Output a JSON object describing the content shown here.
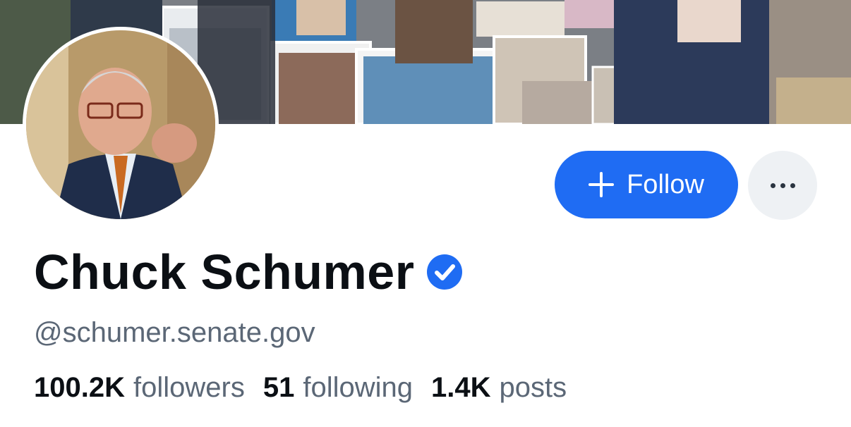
{
  "profile": {
    "display_name": "Chuck Schumer",
    "handle": "@schumer.senate.gov",
    "verified": true,
    "verified_icon": "verified-check-icon",
    "accent_color": "#1f6cf3"
  },
  "actions": {
    "follow_label": "Follow",
    "follow_icon": "plus-icon",
    "more_icon": "more-dots-icon"
  },
  "stats": [
    {
      "value": "100.2K",
      "label": "followers"
    },
    {
      "value": "51",
      "label": "following"
    },
    {
      "value": "1.4K",
      "label": "posts"
    }
  ]
}
